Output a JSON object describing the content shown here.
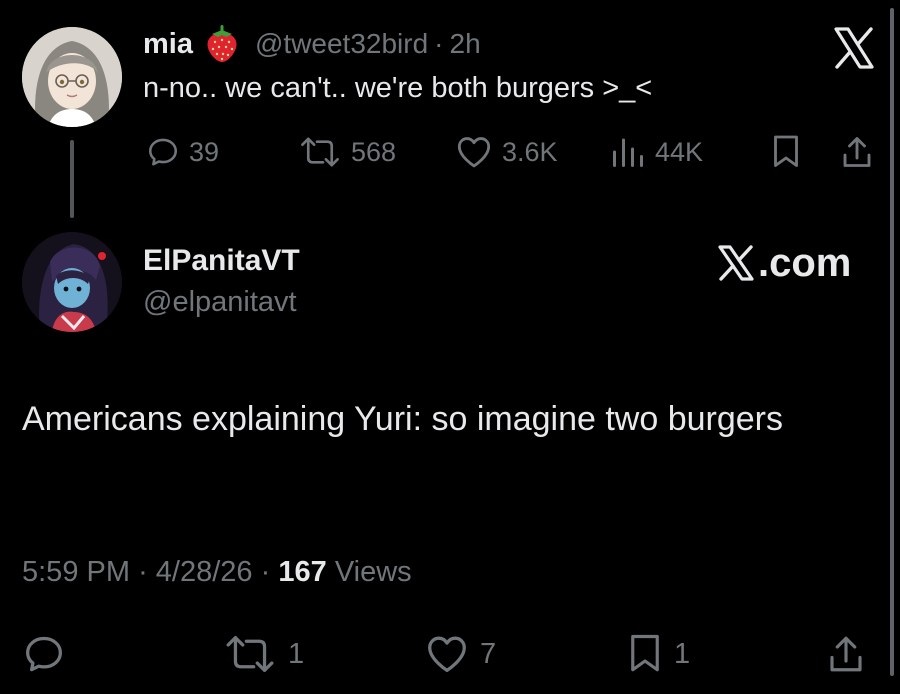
{
  "parent_tweet": {
    "name": "mia",
    "emoji_icon": "strawberry-icon",
    "handle": "@tweet32bird",
    "separator": "·",
    "time": "2h",
    "text": "n-no.. we can't.. we're both burgers >_<",
    "actions": {
      "replies": "39",
      "reposts": "568",
      "likes": "3.6K",
      "views": "44K"
    }
  },
  "main_tweet": {
    "name": "ElPanitaVT",
    "handle": "@elpanitavt",
    "watermark": ".com",
    "text": "Americans explaining Yuri: so imagine two burgers",
    "meta": {
      "time": "5:59 PM",
      "sep1": "·",
      "date": "4/28/26",
      "sep2": "·",
      "views_count": "167",
      "views_label": "Views"
    },
    "actions": {
      "reposts": "1",
      "likes": "7",
      "bookmarks": "1"
    }
  },
  "colors": {
    "background": "#000000",
    "text_primary": "#e7e9ea",
    "text_secondary": "#71767b",
    "thread_line": "#535659"
  }
}
